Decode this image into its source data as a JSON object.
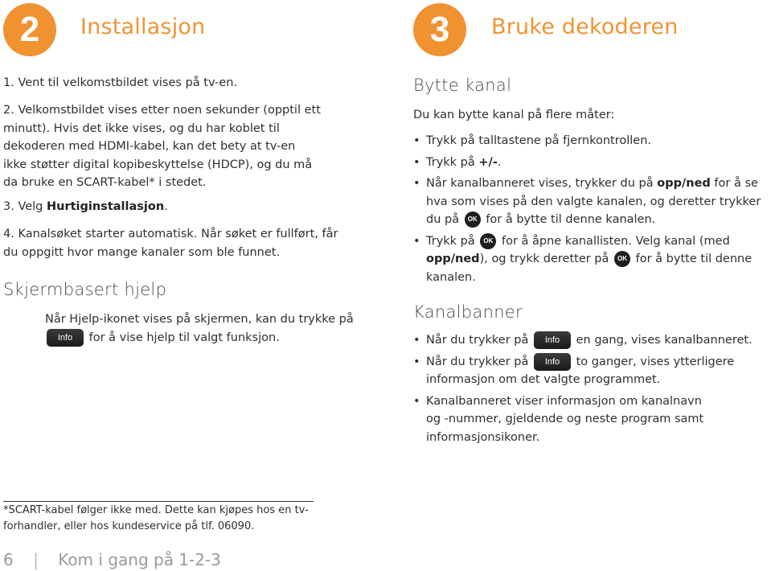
{
  "left": {
    "step_number": "2",
    "title": "Installasjon",
    "steps": [
      {
        "text": "1. Vent til velkomstbildet vises på tv-en."
      },
      {
        "text": "2. Velkomstbildet vises etter noen sekunder (opptil ett minutt). Hvis det ikke vises, og du har koblet til dekoderen med HDMI-kabel, kan det bety at tv-en ikke støtter digital kopibeskyttelse (HDCP), og du må da bruke en SCART-kabel* i stedet."
      },
      {
        "prefix": "3. Velg ",
        "bold": "Hurtiginstallasjon",
        "suffix": "."
      },
      {
        "text": "4. Kanalsøket starter automatisk. Når søket er fullført, får du oppgitt hvor mange kanaler som ble funnet."
      }
    ],
    "help_heading": "Skjermbasert hjelp",
    "help_text_1": "Når Hjelp-ikonet vises på skjermen, kan du trykke på",
    "help_text_2": "for å vise hjelp til valgt funksjon."
  },
  "right": {
    "step_number": "3",
    "title": "Bruke dekoderen",
    "section1_heading": "Bytte kanal",
    "section1_intro": "Du kan bytte kanal på flere måter:",
    "bullets1": {
      "b1": "Trykk på talltastene på fjernkontrollen.",
      "b2_prefix": "Trykk på ",
      "b2_bold": "+/-",
      "b2_suffix": ".",
      "b3_prefix": "Når kanalbanneret vises, trykker du på ",
      "b3_bold": "opp/ned",
      "b3_mid": " for å se hva som vises på den valgte kanalen, og deretter trykker du på",
      "b3_suffix": "for å bytte til denne kanalen.",
      "b4_prefix": "Trykk på",
      "b4_mid": "for å åpne kanallisten. Velg kanal (med ",
      "b4_bold": "opp/ned",
      "b4_mid2": "), og trykk deretter på",
      "b4_suffix": "for å bytte til denne kanalen."
    },
    "section2_heading": "Kanalbanner",
    "bullets2": {
      "b1_prefix": "Når du trykker på",
      "b1_suffix": "en gang, vises kanalbanneret.",
      "b2_prefix": "Når du trykker på",
      "b2_suffix": "to ganger, vises ytterligere informasjon om det valgte programmet.",
      "b3": "Kanalbanneret viser informasjon om kanalnavn og -nummer, gjeldende og neste program samt informasjonsikoner."
    }
  },
  "buttons": {
    "info_label": "Info",
    "ok_label": "OK"
  },
  "footnote": "*SCART-kabel følger ikke med. Dette kan kjøpes hos en tv-forhandler, eller hos kundeservice på tlf. 06090.",
  "page_footer": {
    "page_number": "6",
    "separator": "|",
    "title": "Kom i gang på 1-2-3"
  },
  "colors": {
    "accent": "#f0922f"
  }
}
